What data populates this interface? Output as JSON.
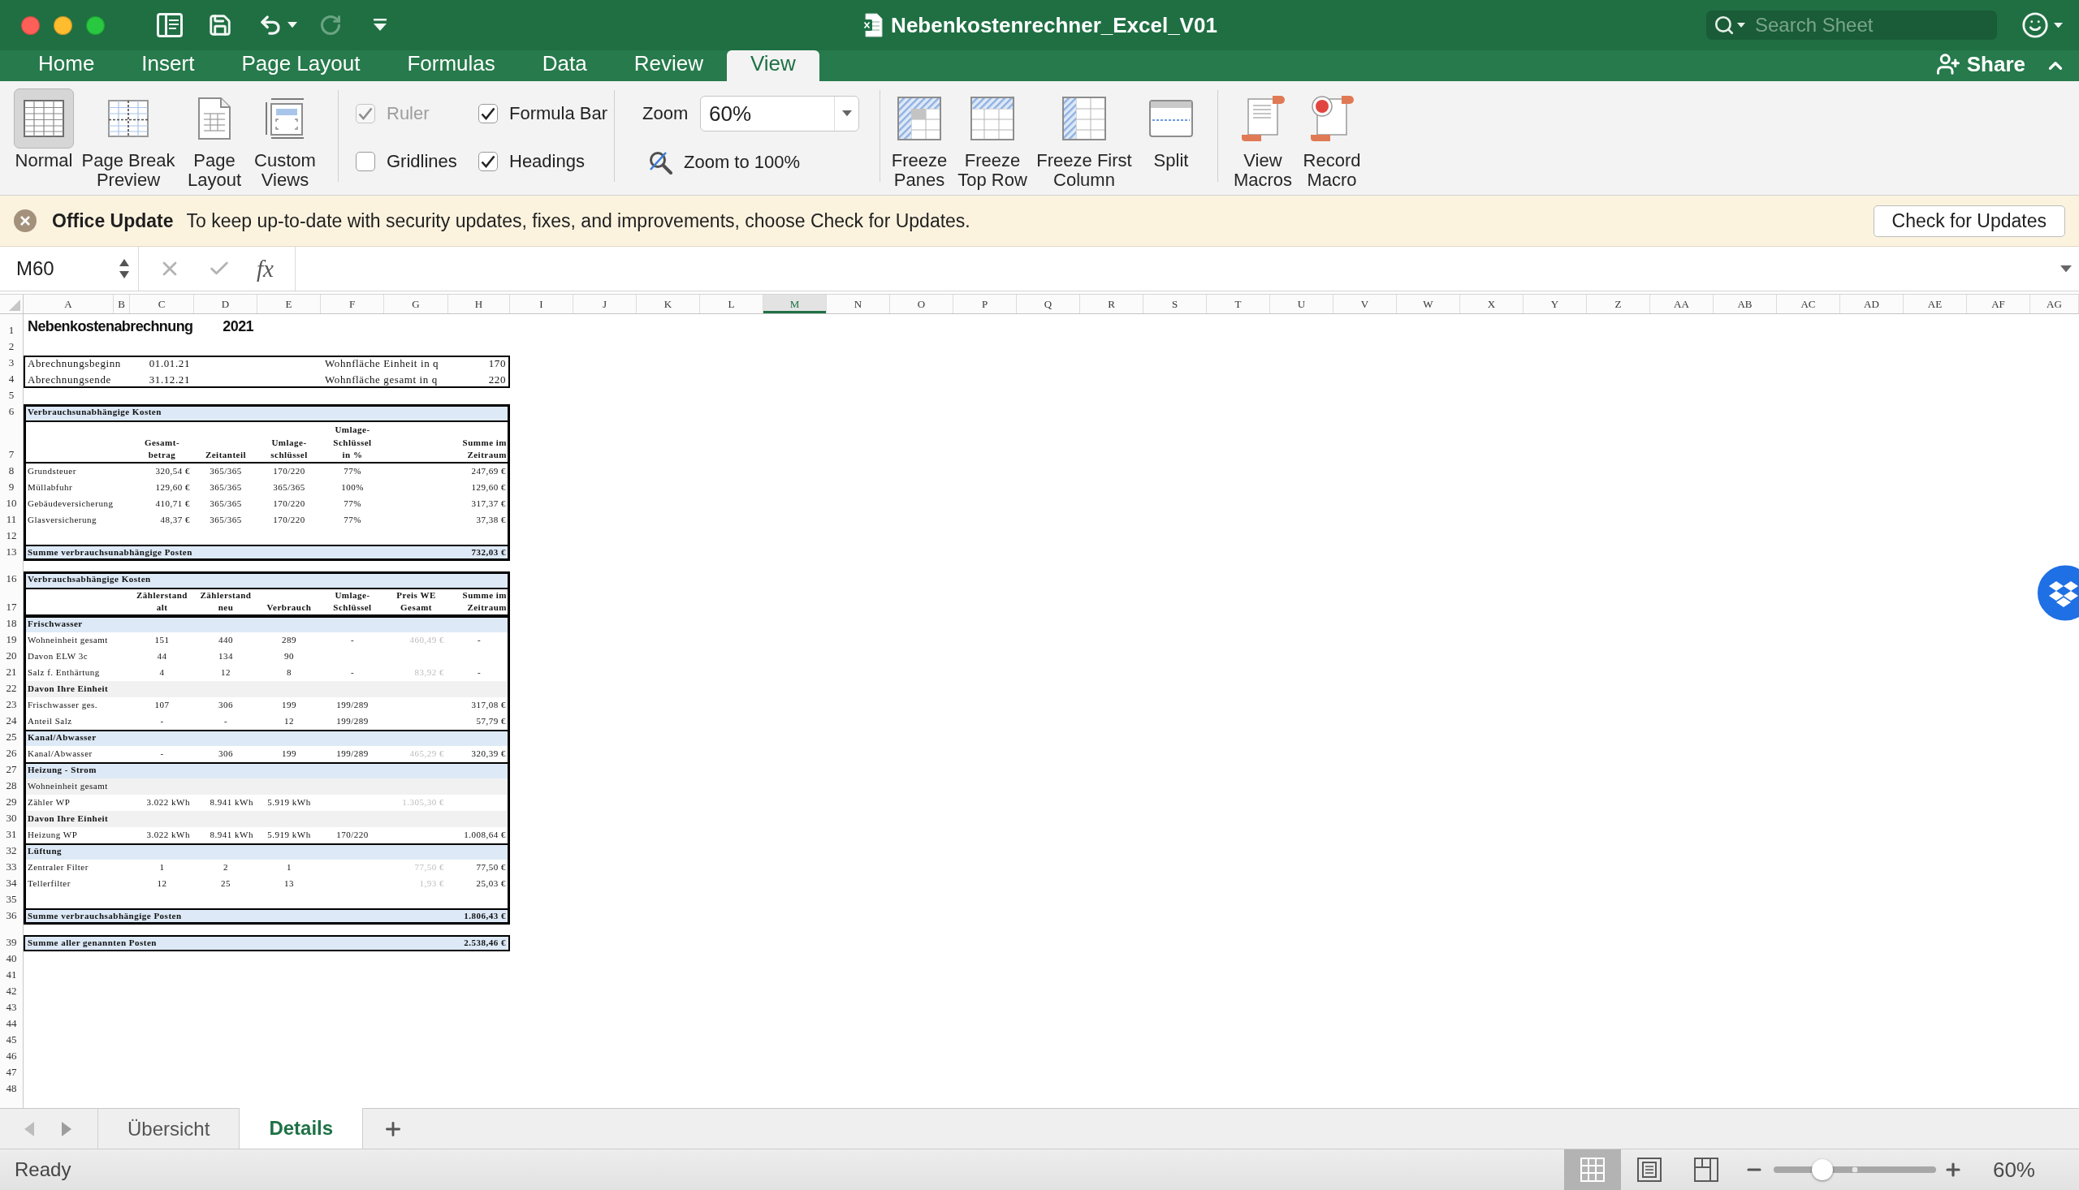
{
  "window": {
    "title": "Nebenkostenrechner_Excel_V01",
    "search": {
      "placeholder": "Search Sheet"
    }
  },
  "quick_access": [
    {
      "kind": "sidebar",
      "disabled": false
    },
    {
      "kind": "save",
      "disabled": false
    },
    {
      "kind": "undo",
      "disabled": false
    },
    {
      "kind": "redo",
      "disabled": true
    },
    {
      "kind": "customize",
      "disabled": false
    }
  ],
  "ribbon_tabs": [
    {
      "label": "Home",
      "selected": false
    },
    {
      "label": "Insert",
      "selected": false
    },
    {
      "label": "Page Layout",
      "selected": false
    },
    {
      "label": "Formulas",
      "selected": false
    },
    {
      "label": "Data",
      "selected": false
    },
    {
      "label": "Review",
      "selected": false
    },
    {
      "label": "View",
      "selected": true
    }
  ],
  "share": {
    "label": "Share"
  },
  "ribbon": {
    "views": [
      {
        "kind": "normal",
        "label": "Normal",
        "selected": true
      },
      {
        "kind": "page-break",
        "label": "Page Break\nPreview",
        "selected": false
      },
      {
        "kind": "page-layout",
        "label": "Page\nLayout",
        "selected": false
      },
      {
        "kind": "custom",
        "label": "Custom\nViews",
        "selected": false
      }
    ],
    "options": [
      {
        "label": "Ruler",
        "checked": true,
        "disabled": true
      },
      {
        "label": "Formula Bar",
        "checked": true,
        "disabled": false
      },
      {
        "label": "Gridlines",
        "checked": false,
        "disabled": false
      },
      {
        "label": "Headings",
        "checked": true,
        "disabled": false
      }
    ],
    "zoom": {
      "label": "Zoom",
      "value": "60%",
      "reset_label": "Zoom to 100%"
    },
    "freeze": [
      {
        "kind": "panes",
        "label": "Freeze\nPanes"
      },
      {
        "kind": "top-row",
        "label": "Freeze\nTop Row"
      },
      {
        "kind": "first-column",
        "label": "Freeze First\nColumn"
      },
      {
        "kind": "split",
        "label": "Split"
      }
    ],
    "macros": [
      {
        "kind": "view",
        "label": "View\nMacros"
      },
      {
        "kind": "record",
        "label": "Record\nMacro"
      }
    ]
  },
  "notice": {
    "title": "Office Update",
    "message": "To keep up-to-date with security updates, fixes, and improvements, choose Check for Updates.",
    "button": "Check for Updates"
  },
  "formula_bar": {
    "name_box": "M60",
    "function_label": "fx"
  },
  "sheet": {
    "columns": [
      {
        "label": "A",
        "selected": false
      },
      {
        "label": "B",
        "selected": false
      },
      {
        "label": "C",
        "selected": false
      },
      {
        "label": "D",
        "selected": false
      },
      {
        "label": "E",
        "selected": false
      },
      {
        "label": "F",
        "selected": false
      },
      {
        "label": "G",
        "selected": false
      },
      {
        "label": "H",
        "selected": false
      },
      {
        "label": "I",
        "selected": false
      },
      {
        "label": "J",
        "selected": false
      },
      {
        "label": "K",
        "selected": false
      },
      {
        "label": "L",
        "selected": false
      },
      {
        "label": "M",
        "selected": true
      },
      {
        "label": "N",
        "selected": false
      },
      {
        "label": "O",
        "selected": false
      },
      {
        "label": "P",
        "selected": false
      },
      {
        "label": "Q",
        "selected": false
      },
      {
        "label": "R",
        "selected": false
      },
      {
        "label": "S",
        "selected": false
      },
      {
        "label": "T",
        "selected": false
      },
      {
        "label": "U",
        "selected": false
      },
      {
        "label": "V",
        "selected": false
      },
      {
        "label": "W",
        "selected": false
      },
      {
        "label": "X",
        "selected": false
      },
      {
        "label": "Y",
        "selected": false
      },
      {
        "label": "Z",
        "selected": false
      },
      {
        "label": "AA",
        "selected": false
      },
      {
        "label": "AB",
        "selected": false
      },
      {
        "label": "AC",
        "selected": false
      },
      {
        "label": "AD",
        "selected": false
      },
      {
        "label": "AE",
        "selected": false
      },
      {
        "label": "AF",
        "selected": false
      },
      {
        "label": "AG",
        "selected": false
      }
    ],
    "blocks": [
      {
        "kind": "plain",
        "rows": [
          {
            "number": "1",
            "kind": "title",
            "cells": {
              "A": {
                "kind": "label",
                "text": "Nebenkostenabrechnung",
                "muted": false
              },
              "D": {
                "kind": "amount",
                "text": "2021",
                "muted": false
              }
            }
          },
          {
            "number": "2",
            "kind": "data"
          }
        ]
      },
      {
        "kind": "info",
        "rows": [
          {
            "number": "3",
            "kind": "data",
            "cells": {
              "A": {
                "kind": "label",
                "text": "Abrechnungsbeginn",
                "muted": false
              },
              "C": {
                "kind": "amount",
                "text": "01.01.21",
                "muted": false
              },
              "F": {
                "kind": "label",
                "text": "Wohnfläche Einheit in q",
                "muted": false
              },
              "H": {
                "kind": "amount",
                "text": "170",
                "muted": false
              }
            }
          },
          {
            "number": "4",
            "kind": "data",
            "cells": {
              "A": {
                "kind": "label",
                "text": "Abrechnungsende",
                "muted": false
              },
              "C": {
                "kind": "amount",
                "text": "31.12.21",
                "muted": false
              },
              "F": {
                "kind": "label",
                "text": "Wohnfläche gesamt in q",
                "muted": false
              },
              "H": {
                "kind": "amount",
                "text": "220",
                "muted": false
              }
            }
          }
        ]
      },
      {
        "kind": "plain",
        "rows": [
          {
            "number": "5",
            "kind": "data"
          }
        ]
      },
      {
        "kind": "table",
        "rows": [
          {
            "number": "6",
            "kind": "section",
            "cells": {
              "A": {
                "kind": "label",
                "text": "Verbrauchsunabhängige Kosten",
                "muted": false
              }
            }
          },
          {
            "number": "7",
            "kind": "header",
            "cells": {
              "C": {
                "kind": "value",
                "text": "Gesamt-\nbetrag",
                "muted": false
              },
              "D": {
                "kind": "value",
                "text": "Zeitanteil",
                "muted": false
              },
              "E": {
                "kind": "value",
                "text": "Umlage-\nschlüssel",
                "muted": false
              },
              "F": {
                "kind": "value",
                "text": "Umlage-\nSchlüssel\nin %",
                "muted": false
              },
              "H": {
                "kind": "amount",
                "text": "Summe im\nZeitraum",
                "muted": false
              }
            }
          },
          {
            "number": "8",
            "kind": "data",
            "cells": {
              "A": {
                "kind": "label",
                "text": "Grundsteuer",
                "muted": false
              },
              "C": {
                "kind": "amount",
                "text": "320,54 €",
                "muted": false
              },
              "D": {
                "kind": "value",
                "text": "365/365",
                "muted": false
              },
              "E": {
                "kind": "value",
                "text": "170/220",
                "muted": false
              },
              "F": {
                "kind": "value",
                "text": "77%",
                "muted": false
              },
              "H": {
                "kind": "amount",
                "text": "247,69 €",
                "muted": false
              }
            }
          },
          {
            "number": "9",
            "kind": "data",
            "cells": {
              "A": {
                "kind": "label",
                "text": "Müllabfuhr",
                "muted": false
              },
              "C": {
                "kind": "amount",
                "text": "129,60 €",
                "muted": false
              },
              "D": {
                "kind": "value",
                "text": "365/365",
                "muted": false
              },
              "E": {
                "kind": "value",
                "text": "365/365",
                "muted": false
              },
              "F": {
                "kind": "value",
                "text": "100%",
                "muted": false
              },
              "H": {
                "kind": "amount",
                "text": "129,60 €",
                "muted": false
              }
            }
          },
          {
            "number": "10",
            "kind": "data",
            "cells": {
              "A": {
                "kind": "label",
                "text": "Gebäudeversicherung",
                "muted": false
              },
              "C": {
                "kind": "amount",
                "text": "410,71 €",
                "muted": false
              },
              "D": {
                "kind": "value",
                "text": "365/365",
                "muted": false
              },
              "E": {
                "kind": "value",
                "text": "170/220",
                "muted": false
              },
              "F": {
                "kind": "value",
                "text": "77%",
                "muted": false
              },
              "H": {
                "kind": "amount",
                "text": "317,37 €",
                "muted": false
              }
            }
          },
          {
            "number": "11",
            "kind": "data",
            "cells": {
              "A": {
                "kind": "label",
                "text": "Glasversicherung",
                "muted": false
              },
              "C": {
                "kind": "amount",
                "text": "48,37 €",
                "muted": false
              },
              "D": {
                "kind": "value",
                "text": "365/365",
                "muted": false
              },
              "E": {
                "kind": "value",
                "text": "170/220",
                "muted": false
              },
              "F": {
                "kind": "value",
                "text": "77%",
                "muted": false
              },
              "H": {
                "kind": "amount",
                "text": "37,38 €",
                "muted": false
              }
            }
          },
          {
            "number": "12",
            "kind": "data"
          },
          {
            "number": "13",
            "kind": "total",
            "cells": {
              "A": {
                "kind": "label",
                "text": "Summe verbrauchsunabhängige Posten",
                "muted": false
              },
              "H": {
                "kind": "amount",
                "text": "732,03 €",
                "muted": false
              }
            }
          }
        ]
      },
      {
        "kind": "collapsed"
      },
      {
        "kind": "table",
        "rows": [
          {
            "number": "16",
            "kind": "section",
            "cells": {
              "A": {
                "kind": "label",
                "text": "Verbrauchsabhängige Kosten",
                "muted": false
              }
            }
          },
          {
            "number": "17",
            "kind": "header",
            "cells": {
              "C": {
                "kind": "value",
                "text": "Zählerstand\nalt",
                "muted": false
              },
              "D": {
                "kind": "value",
                "text": "Zählerstand\nneu",
                "muted": false
              },
              "E": {
                "kind": "value",
                "text": "Verbrauch",
                "muted": false
              },
              "F": {
                "kind": "value",
                "text": "Umlage-\nSchlüssel",
                "muted": false
              },
              "G": {
                "kind": "value",
                "text": "Preis WE\nGesamt",
                "muted": false
              },
              "H": {
                "kind": "amount",
                "text": "Summe im\nZeitraum",
                "muted": false
              }
            }
          },
          {
            "number": "18",
            "kind": "section",
            "cells": {
              "A": {
                "kind": "label",
                "text": "Frischwasser",
                "muted": false
              }
            }
          },
          {
            "number": "19",
            "kind": "data",
            "cells": {
              "A": {
                "kind": "label",
                "text": "Wohneinheit gesamt",
                "muted": false
              },
              "C": {
                "kind": "value",
                "text": "151",
                "muted": false
              },
              "D": {
                "kind": "value",
                "text": "440",
                "muted": false
              },
              "E": {
                "kind": "value",
                "text": "289",
                "muted": false
              },
              "F": {
                "kind": "value",
                "text": "-",
                "muted": false
              },
              "G": {
                "kind": "amount",
                "text": "460,49 €",
                "muted": true
              },
              "H": {
                "kind": "value",
                "text": "-",
                "muted": false
              }
            }
          },
          {
            "number": "20",
            "kind": "data",
            "cells": {
              "A": {
                "kind": "label",
                "text": "Davon ELW 3c",
                "muted": false
              },
              "C": {
                "kind": "value",
                "text": "44",
                "muted": false
              },
              "D": {
                "kind": "value",
                "text": "134",
                "muted": false
              },
              "E": {
                "kind": "value",
                "text": "90",
                "muted": false
              }
            }
          },
          {
            "number": "21",
            "kind": "data",
            "cells": {
              "A": {
                "kind": "label",
                "text": "Salz f. Enthärtung",
                "muted": false
              },
              "C": {
                "kind": "value",
                "text": "4",
                "muted": false
              },
              "D": {
                "kind": "value",
                "text": "12",
                "muted": false
              },
              "E": {
                "kind": "value",
                "text": "8",
                "muted": false
              },
              "F": {
                "kind": "value",
                "text": "-",
                "muted": false
              },
              "G": {
                "kind": "amount",
                "text": "83,92 €",
                "muted": true
              },
              "H": {
                "kind": "value",
                "text": "-",
                "muted": false
              }
            }
          },
          {
            "number": "22",
            "kind": "subsection",
            "cells": {
              "A": {
                "kind": "label",
                "text": "Davon Ihre Einheit",
                "muted": false
              }
            }
          },
          {
            "number": "23",
            "kind": "data",
            "cells": {
              "A": {
                "kind": "label",
                "text": "Frischwasser ges.",
                "muted": false
              },
              "C": {
                "kind": "value",
                "text": "107",
                "muted": false
              },
              "D": {
                "kind": "value",
                "text": "306",
                "muted": false
              },
              "E": {
                "kind": "value",
                "text": "199",
                "muted": false
              },
              "F": {
                "kind": "value",
                "text": "199/289",
                "muted": false
              },
              "H": {
                "kind": "amount",
                "text": "317,08 €",
                "muted": false
              }
            }
          },
          {
            "number": "24",
            "kind": "data",
            "cells": {
              "A": {
                "kind": "label",
                "text": "Anteil Salz",
                "muted": false
              },
              "C": {
                "kind": "value",
                "text": "-",
                "muted": false
              },
              "D": {
                "kind": "value",
                "text": "-",
                "muted": false
              },
              "E": {
                "kind": "value",
                "text": "12",
                "muted": false
              },
              "F": {
                "kind": "value",
                "text": "199/289",
                "muted": false
              },
              "H": {
                "kind": "amount",
                "text": "57,79 €",
                "muted": false
              }
            }
          },
          {
            "number": "25",
            "kind": "section",
            "cells": {
              "A": {
                "kind": "label",
                "text": "Kanal/Abwasser",
                "muted": false
              }
            }
          },
          {
            "number": "26",
            "kind": "data",
            "cells": {
              "A": {
                "kind": "label",
                "text": "Kanal/Abwasser",
                "muted": false
              },
              "C": {
                "kind": "value",
                "text": "-",
                "muted": false
              },
              "D": {
                "kind": "value",
                "text": "306",
                "muted": false
              },
              "E": {
                "kind": "value",
                "text": "199",
                "muted": false
              },
              "F": {
                "kind": "value",
                "text": "199/289",
                "muted": false
              },
              "G": {
                "kind": "amount",
                "text": "465,29 €",
                "muted": true
              },
              "H": {
                "kind": "amount",
                "text": "320,39 €",
                "muted": false
              }
            }
          },
          {
            "number": "27",
            "kind": "section",
            "cells": {
              "A": {
                "kind": "label",
                "text": "Heizung - Strom",
                "muted": false
              }
            }
          },
          {
            "number": "28",
            "kind": "note",
            "cells": {
              "A": {
                "kind": "label",
                "text": "Wohneinheit gesamt",
                "muted": false
              }
            }
          },
          {
            "number": "29",
            "kind": "data",
            "cells": {
              "A": {
                "kind": "label",
                "text": "Zähler WP",
                "muted": false
              },
              "C": {
                "kind": "amount",
                "text": "3.022 kWh",
                "muted": false
              },
              "D": {
                "kind": "amount",
                "text": "8.941 kWh",
                "muted": false
              },
              "E": {
                "kind": "value",
                "text": "5.919 kWh",
                "muted": false
              },
              "G": {
                "kind": "amount",
                "text": "1.305,30 €",
                "muted": true
              }
            }
          },
          {
            "number": "30",
            "kind": "subsection",
            "cells": {
              "A": {
                "kind": "label",
                "text": "Davon Ihre Einheit",
                "muted": false
              }
            }
          },
          {
            "number": "31",
            "kind": "data",
            "cells": {
              "A": {
                "kind": "label",
                "text": "Heizung WP",
                "muted": false
              },
              "C": {
                "kind": "amount",
                "text": "3.022 kWh",
                "muted": false
              },
              "D": {
                "kind": "amount",
                "text": "8.941 kWh",
                "muted": false
              },
              "E": {
                "kind": "value",
                "text": "5.919 kWh",
                "muted": false
              },
              "F": {
                "kind": "value",
                "text": "170/220",
                "muted": false
              },
              "H": {
                "kind": "amount",
                "text": "1.008,64 €",
                "muted": false
              }
            }
          },
          {
            "number": "32",
            "kind": "section",
            "cells": {
              "A": {
                "kind": "label",
                "text": "Lüftung",
                "muted": false
              }
            }
          },
          {
            "number": "33",
            "kind": "data",
            "cells": {
              "A": {
                "kind": "label",
                "text": "Zentraler Filter",
                "muted": false
              },
              "C": {
                "kind": "value",
                "text": "1",
                "muted": false
              },
              "D": {
                "kind": "value",
                "text": "2",
                "muted": false
              },
              "E": {
                "kind": "value",
                "text": "1",
                "muted": false
              },
              "G": {
                "kind": "amount",
                "text": "77,50 €",
                "muted": true
              },
              "H": {
                "kind": "amount",
                "text": "77,50 €",
                "muted": false
              }
            }
          },
          {
            "number": "34",
            "kind": "data",
            "cells": {
              "A": {
                "kind": "label",
                "text": "Tellerfilter",
                "muted": false
              },
              "C": {
                "kind": "value",
                "text": "12",
                "muted": false
              },
              "D": {
                "kind": "value",
                "text": "25",
                "muted": false
              },
              "E": {
                "kind": "value",
                "text": "13",
                "muted": false
              },
              "G": {
                "kind": "amount",
                "text": "1,93 €",
                "muted": true
              },
              "H": {
                "kind": "amount",
                "text": "25,03 €",
                "muted": false
              }
            }
          },
          {
            "number": "35",
            "kind": "data"
          },
          {
            "number": "36",
            "kind": "total",
            "cells": {
              "A": {
                "kind": "label",
                "text": "Summe verbrauchsabhängige Posten",
                "muted": false
              },
              "H": {
                "kind": "amount",
                "text": "1.806,43 €",
                "muted": false
              }
            }
          }
        ]
      },
      {
        "kind": "collapsed"
      },
      {
        "kind": "summary",
        "rows": [
          {
            "number": "39",
            "kind": "total",
            "cells": {
              "A": {
                "kind": "label",
                "text": "Summe aller genannten Posten",
                "muted": false
              },
              "H": {
                "kind": "amount",
                "text": "2.538,46 €",
                "muted": false
              }
            }
          }
        ]
      },
      {
        "kind": "plain",
        "rows": [
          {
            "number": "40",
            "kind": "data"
          },
          {
            "number": "41",
            "kind": "data"
          },
          {
            "number": "42",
            "kind": "data"
          },
          {
            "number": "43",
            "kind": "data"
          },
          {
            "number": "44",
            "kind": "data"
          },
          {
            "number": "45",
            "kind": "data"
          },
          {
            "number": "46",
            "kind": "data"
          },
          {
            "number": "47",
            "kind": "data"
          },
          {
            "number": "48",
            "kind": "data"
          }
        ]
      }
    ]
  },
  "sheet_tabs": [
    {
      "label": "Übersicht",
      "selected": false
    },
    {
      "label": "Details",
      "selected": true
    }
  ],
  "status_bar": {
    "status": "Ready",
    "views": [
      {
        "kind": "normal",
        "selected": true
      },
      {
        "kind": "page-layout",
        "selected": false
      },
      {
        "kind": "page-break",
        "selected": false
      }
    ],
    "zoom": {
      "level": 0.3,
      "reading": "60%"
    }
  }
}
